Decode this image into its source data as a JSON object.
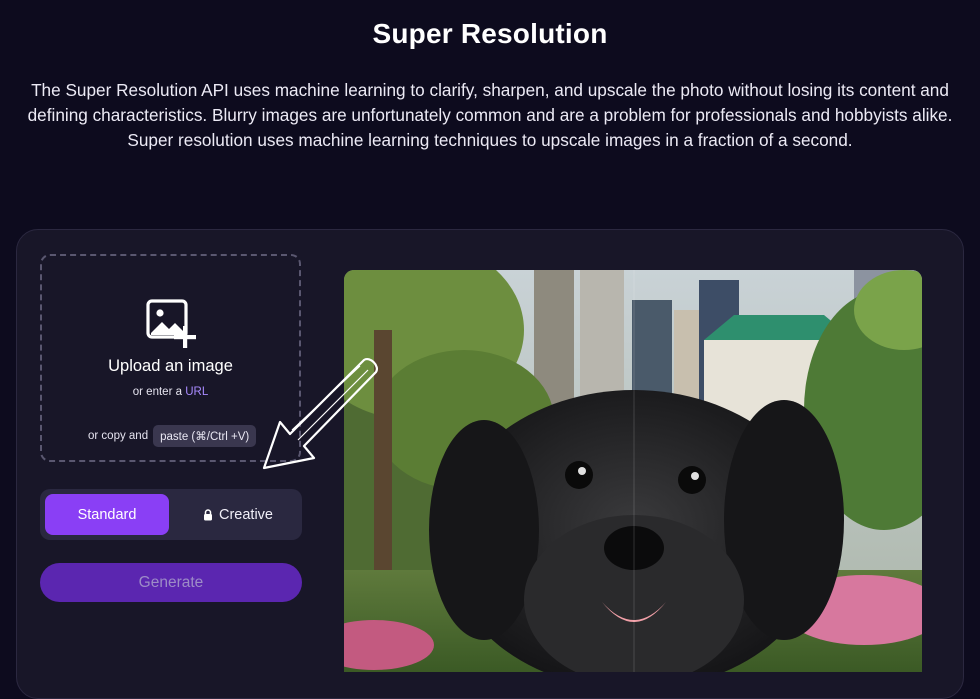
{
  "header": {
    "title": "Super Resolution",
    "description": "The Super Resolution API uses machine learning to clarify, sharpen, and upscale the photo without losing its content and defining characteristics. Blurry images are unfortunately common and are a problem for professionals and hobbyists alike. Super resolution uses machine learning techniques to upscale images in a fraction of a second."
  },
  "upload": {
    "icon": "image-plus-icon",
    "title": "Upload an image",
    "url_prefix": "or enter a",
    "url_link": "URL",
    "paste_prefix": "or copy and",
    "paste_chip": "paste (⌘/Ctrl +V)"
  },
  "modes": {
    "standard_label": "Standard",
    "creative_label": "Creative",
    "creative_icon": "lock-icon",
    "selected": "Standard"
  },
  "actions": {
    "generate_label": "Generate"
  },
  "colors": {
    "background": "#0d0b1e",
    "card": "#181628",
    "accent": "#8a3ff5",
    "generate": "#5b26b0",
    "link": "#a98bff"
  }
}
